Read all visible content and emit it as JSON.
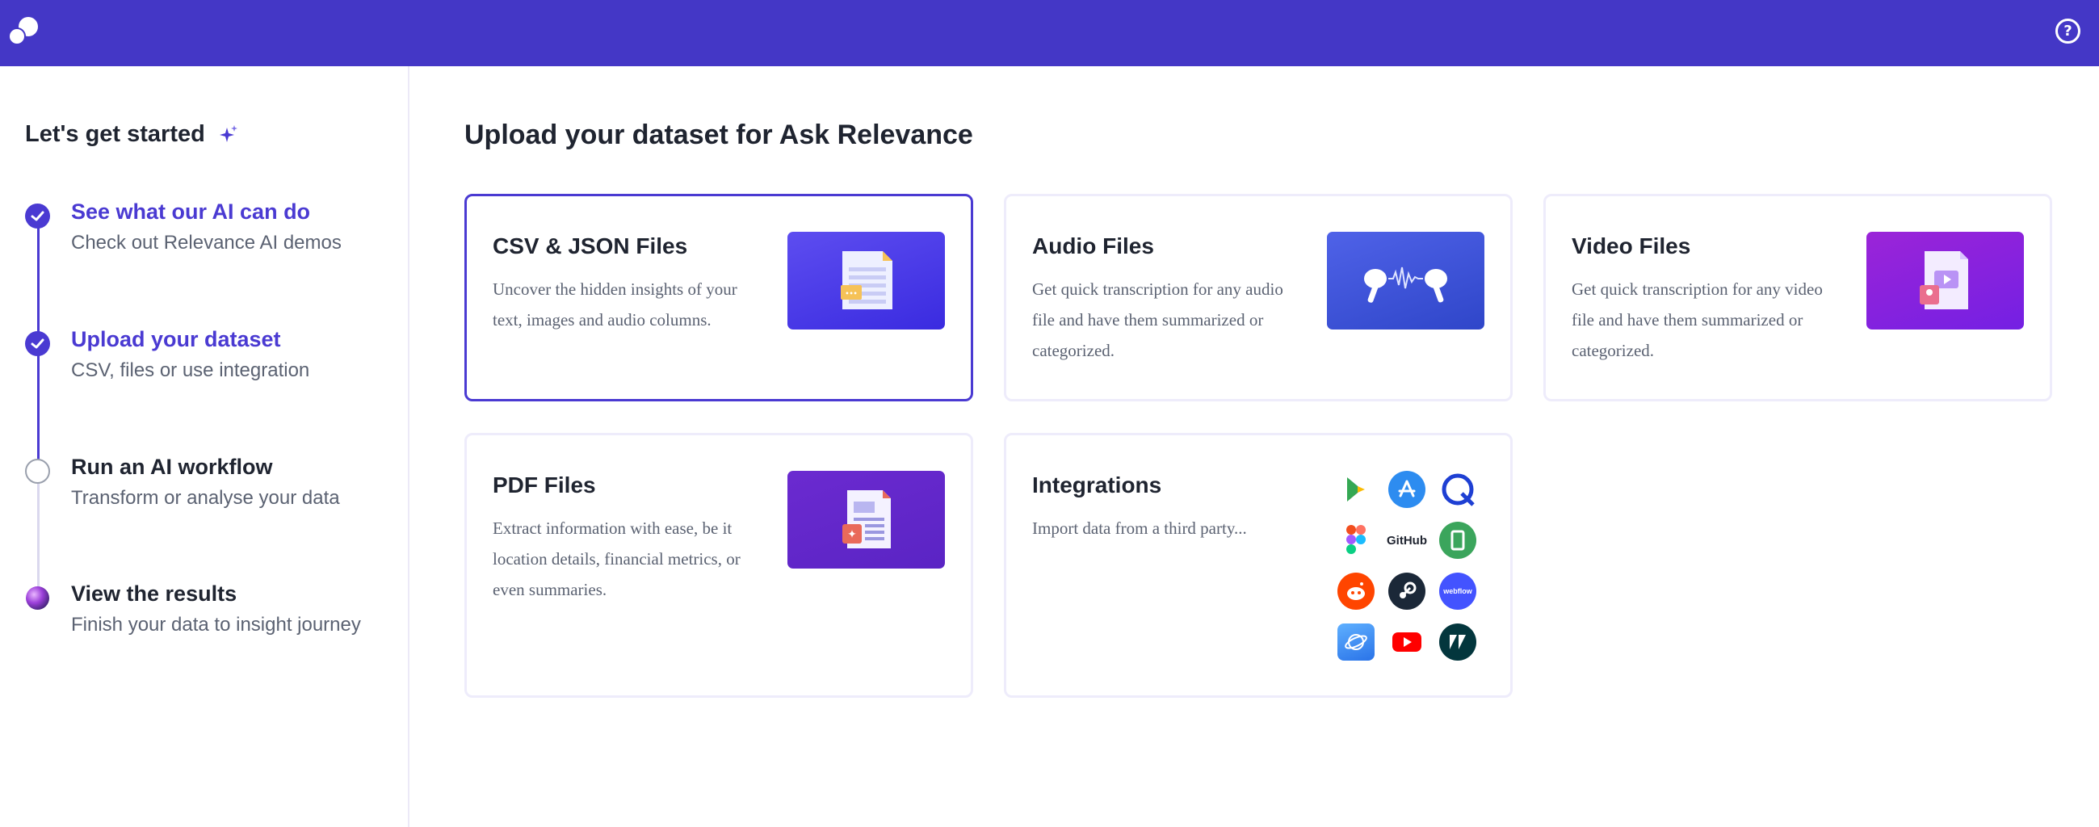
{
  "topbar": {
    "help_label": "?"
  },
  "sidebar": {
    "title": "Let's get started",
    "steps": [
      {
        "title": "See what our AI can do",
        "subtitle": "Check out Relevance AI demos",
        "status": "done"
      },
      {
        "title": "Upload your dataset",
        "subtitle": "CSV, files or use integration",
        "status": "done"
      },
      {
        "title": "Run an AI workflow",
        "subtitle": "Transform or analyse your data",
        "status": "todo"
      },
      {
        "title": "View the results",
        "subtitle": "Finish your data to insight journey",
        "status": "todo"
      }
    ]
  },
  "main": {
    "title": "Upload your dataset for Ask Relevance",
    "cards": {
      "csv": {
        "title": "CSV & JSON Files",
        "description": "Uncover the hidden insights of your text, images and audio columns."
      },
      "audio": {
        "title": "Audio Files",
        "description": "Get quick transcription for any audio file and have them summarized or categorized."
      },
      "video": {
        "title": "Video Files",
        "description": "Get quick transcription for any video file and have them summarized or categorized."
      },
      "pdf": {
        "title": "PDF Files",
        "description": "Extract information with ease, be it location details, financial metrics, or even summaries."
      },
      "integrations": {
        "title": "Integrations",
        "description": "Import data from a third party...",
        "github_label": "GitHub",
        "webflow_label": "webflow",
        "icons": [
          "google-play-icon",
          "app-store-icon",
          "q-logo-icon",
          "figma-icon",
          "github-icon",
          "green-app-icon",
          "reddit-icon",
          "steam-icon",
          "webflow-icon",
          "globe-app-icon",
          "youtube-icon",
          "zendesk-icon"
        ]
      }
    }
  },
  "colors": {
    "brand": "#4437c6",
    "accent": "#4a3ad2"
  }
}
